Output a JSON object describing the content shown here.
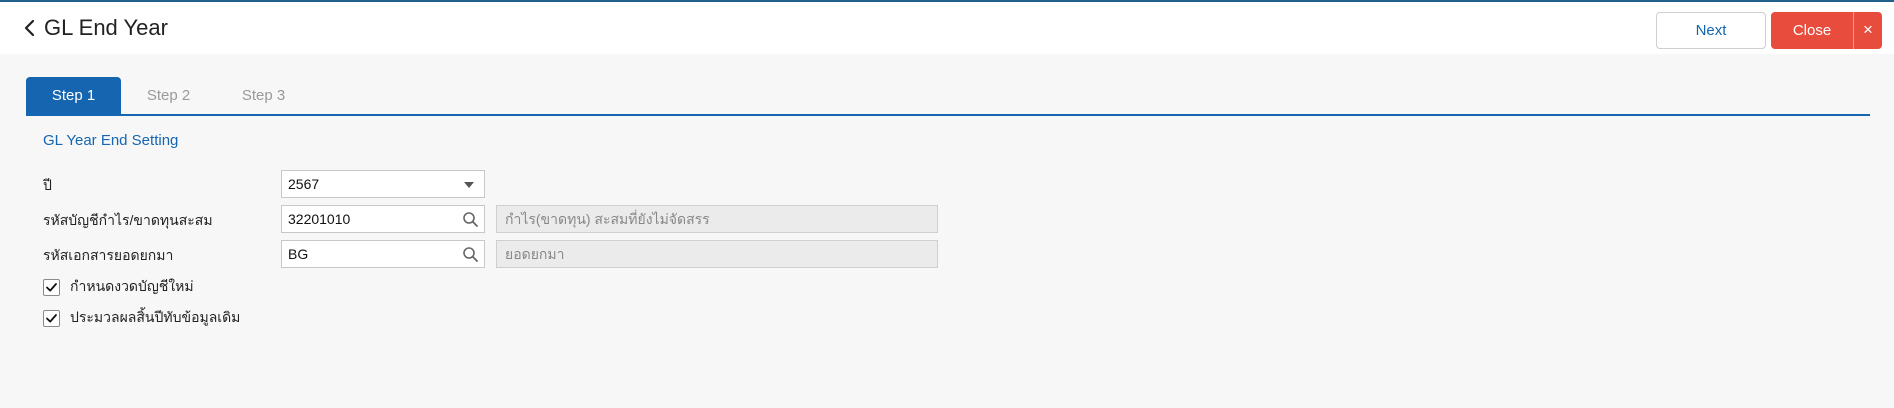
{
  "header": {
    "title": "GL End Year",
    "next_label": "Next",
    "close_label": "Close",
    "close_x": "×"
  },
  "tabs": [
    {
      "label": "Step 1",
      "active": true
    },
    {
      "label": "Step 2",
      "active": false
    },
    {
      "label": "Step 3",
      "active": false
    }
  ],
  "section": {
    "title": "GL Year End Setting"
  },
  "form": {
    "year": {
      "label": "ปี",
      "value": "2567"
    },
    "pl_account": {
      "label": "รหัสบัญชีกำไร/ขาดทุนสะสม",
      "value": "32201010",
      "description": "กำไร(ขาดทุน) สะสมที่ยังไม่จัดสรร"
    },
    "doc_code": {
      "label": "รหัสเอกสารยอดยกมา",
      "value": "BG",
      "description": "ยอดยกมา"
    },
    "new_period": {
      "label": "กำหนดงวดบัญชีใหม่",
      "checked": true
    },
    "reprocess": {
      "label": "ประมวลผลสิ้นปีทับข้อมูลเดิม",
      "checked": true
    }
  },
  "colors": {
    "accent": "#1565b0",
    "danger": "#e84c3d",
    "top_border": "#1f5f8b"
  }
}
